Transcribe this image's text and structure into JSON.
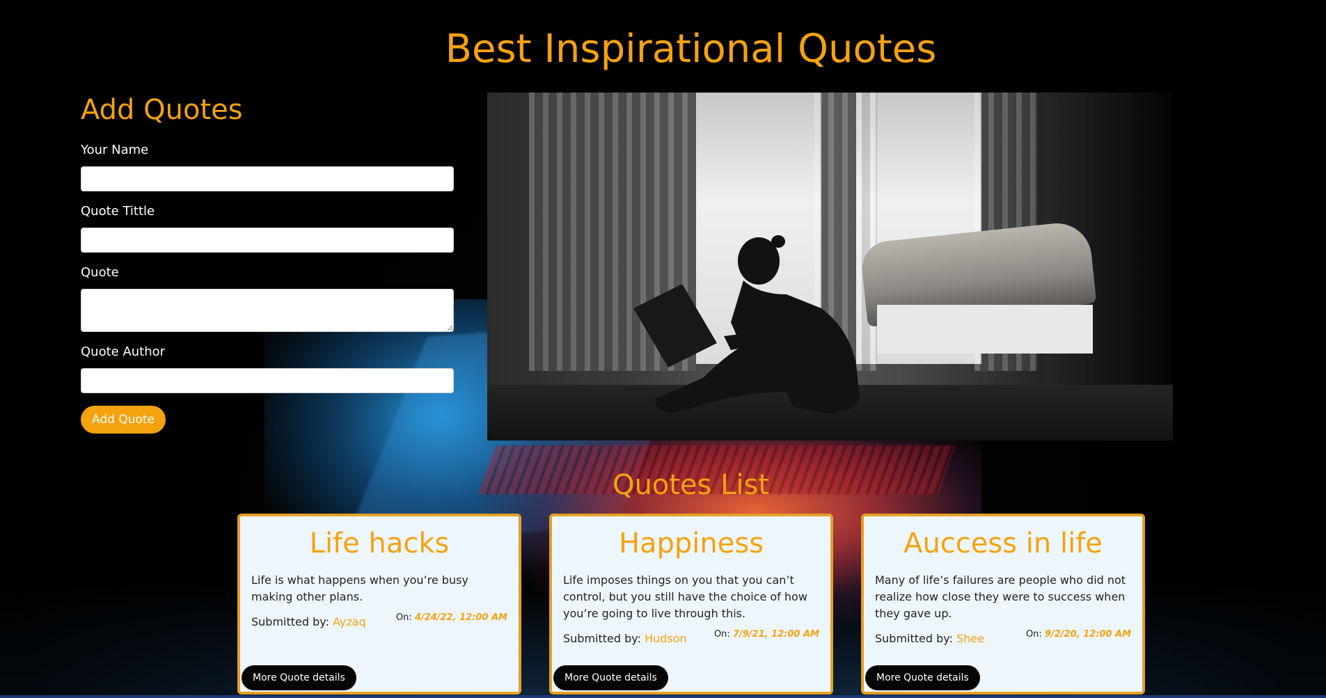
{
  "page": {
    "title": "Best Inspirational Quotes"
  },
  "form": {
    "heading": "Add Quotes",
    "fields": {
      "name_label": "Your Name",
      "title_label": "Quote Tittle",
      "quote_label": "Quote",
      "author_label": "Quote Author"
    },
    "submit_label": "Add Quote"
  },
  "hero": {
    "description": "Person silhouette reading a book by a bright window"
  },
  "quotes": {
    "heading": "Quotes List",
    "submitted_prefix": "Submitted by:",
    "date_prefix": "On:",
    "details_label": "More Quote details",
    "items": [
      {
        "title": "Life hacks",
        "text": "Life is what happens when you’re busy making other plans.",
        "submitter": "Ayzaq",
        "date": "4/24/22, 12:00 AM"
      },
      {
        "title": "Happiness",
        "text": "Life imposes things on you that you can’t control, but you still have the choice of how you’re going to live through this.",
        "submitter": "Hudson",
        "date": "7/9/21, 12:00 AM"
      },
      {
        "title": "Auccess in life",
        "text": "Many of life’s failures are people who did not realize how close they were to success when they gave up.",
        "submitter": "Shee",
        "date": "9/2/20, 12:00 AM"
      }
    ]
  },
  "colors": {
    "accent": "#f5a20f",
    "background": "#020202",
    "card_background": "#eef6fd",
    "card_border": "#e3a028"
  }
}
